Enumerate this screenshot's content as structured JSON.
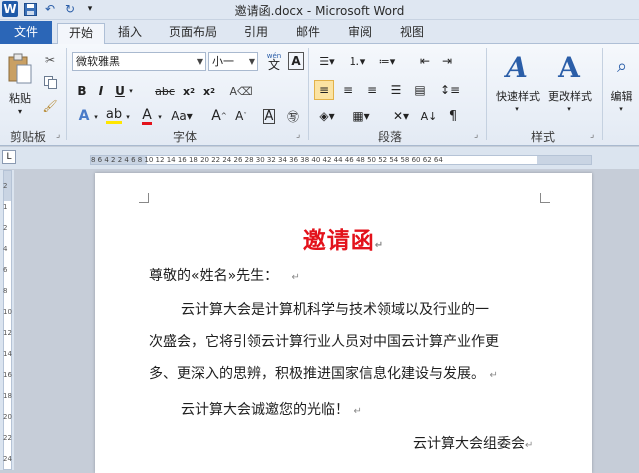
{
  "titlebar": {
    "title": "邀请函.docx - Microsoft Word",
    "qat_logo": "W"
  },
  "tabs": {
    "file": "文件",
    "items": [
      "开始",
      "插入",
      "页面布局",
      "引用",
      "邮件",
      "审阅",
      "视图"
    ]
  },
  "ribbon": {
    "clipboard": {
      "paste": "粘贴",
      "group": "剪贴板"
    },
    "font": {
      "font_name": "微软雅黑",
      "font_size": "小一",
      "wen": "wén",
      "group": "字体"
    },
    "paragraph": {
      "group": "段落"
    },
    "styles": {
      "quick": "快速样式",
      "change": "更改样式",
      "group": "样式"
    },
    "editing": {
      "label": "编辑"
    }
  },
  "ruler": {
    "text": "8  6  4  2     2  4  6  8  10 12 14 16 18 20 22 24 26 28 30 32 34 36 38 40 42 44 46 48 50 52 54     58 60 62 64"
  },
  "document": {
    "heading": "邀请函",
    "greeting": "尊敬的«姓名»先生：",
    "body_line1": "云计算大会是计算机科学与技术领域以及行业的一",
    "body_line2": "次盛会，它将引领云计算行业人员对中国云计算产业作更",
    "body_line3": "多、更深入的思辨，积极推进国家信息化建设与发展。",
    "welcome": "云计算大会诚邀您的光临！",
    "signature": "云计算大会组委会",
    "para_mark": "↵"
  },
  "colors": {
    "heading": "#e3121b",
    "file_tab": "#2b66b7"
  }
}
